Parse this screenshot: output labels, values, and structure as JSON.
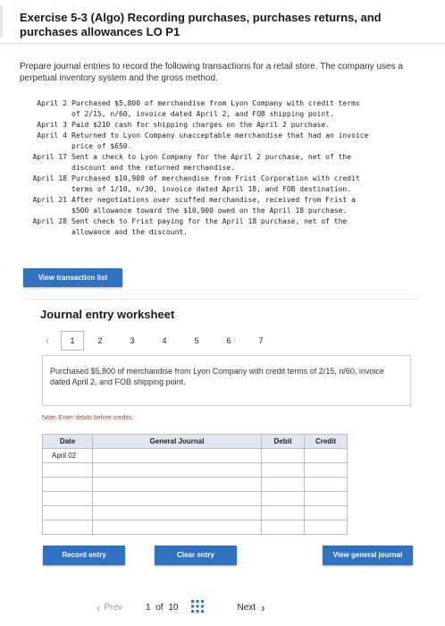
{
  "exercise_title": "Exercise 5-3 (Algo) Recording purchases, purchases returns, and purchases allowances LO P1",
  "intro": "Prepare journal entries to record the following transactions for a retail store. The company uses a perpetual inventory system and the gross method.",
  "transactions": [
    {
      "date": "April 2",
      "text": "Purchased $5,800 of merchandise from Lyon Company with credit terms\nof 2/15, n/60, invoice dated April 2, and FOB shipping point."
    },
    {
      "date": "April 3",
      "text": "Paid $210 cash for shipping charges on the April 2 purchase."
    },
    {
      "date": "April 4",
      "text": "Returned to Lyon Company unacceptable merchandise that had an invoice\nprice of $650."
    },
    {
      "date": "April 17",
      "text": "Sent a check to Lyon Company for the April 2 purchase, net of the\ndiscount and the returned merchandise."
    },
    {
      "date": "April 18",
      "text": "Purchased $10,900 of merchandise from Frist Corporation with credit\nterms of 1/10, n/30, invoice dated April 18, and FOB destination."
    },
    {
      "date": "April 21",
      "text": "After negotiations over scuffed merchandise, received from Frist a\n$500 allowance toward the $10,900 owed on the April 18 purchase."
    },
    {
      "date": "April 28",
      "text": "Sent check to Frist paying for the April 18 purchase, net of the\nallowance and the discount."
    }
  ],
  "view_transaction_list_label": "View transaction list",
  "worksheet": {
    "title": "Journal entry worksheet",
    "pages": [
      "1",
      "2",
      "3",
      "4",
      "5",
      "6",
      "7"
    ],
    "active_page": "1",
    "description": "Purchased $5,800 of merchandise from Lyon Company with credit terms of 2/15, n/60, invoice dated April 2, and FOB shipping point.",
    "note": "Note: Enter debits before credits.",
    "columns": [
      "Date",
      "General Journal",
      "Debit",
      "Credit"
    ],
    "rows": [
      {
        "date": "April 02",
        "account": "",
        "debit": "",
        "credit": ""
      },
      {
        "date": "",
        "account": "",
        "debit": "",
        "credit": ""
      },
      {
        "date": "",
        "account": "",
        "debit": "",
        "credit": ""
      },
      {
        "date": "",
        "account": "",
        "debit": "",
        "credit": ""
      },
      {
        "date": "",
        "account": "",
        "debit": "",
        "credit": ""
      },
      {
        "date": "",
        "account": "",
        "debit": "",
        "credit": ""
      }
    ],
    "record_entry_label": "Record entry",
    "clear_entry_label": "Clear entry",
    "view_general_journal_label": "View general journal"
  },
  "pagination": {
    "prev_label": "Prev",
    "current": "1",
    "of_label": "of",
    "total": "10",
    "next_label": "Next"
  },
  "colors": {
    "button_blue": "#2f72c0",
    "header_blue": "#dfe6f0",
    "note_red": "#c0392b",
    "link_blue": "#2f72c0"
  },
  "icons": [
    "chevron-left-icon",
    "grid-icon",
    "chevron-right-icon"
  ]
}
